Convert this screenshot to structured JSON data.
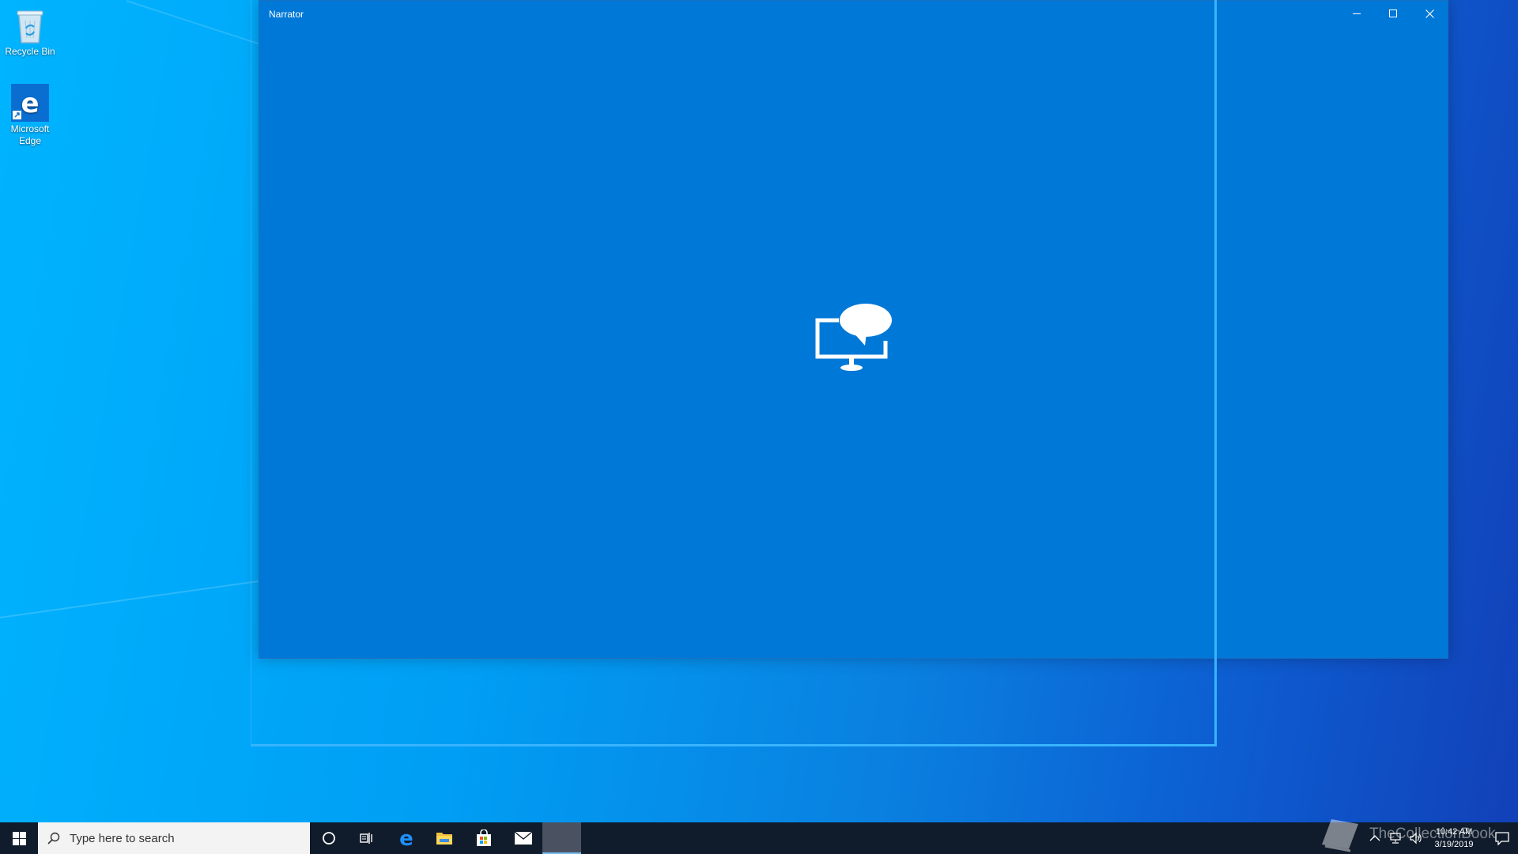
{
  "desktop": {
    "icons": [
      {
        "label": "Recycle Bin",
        "icon": "recycle-bin-icon"
      },
      {
        "label": "Microsoft\nEdge",
        "icon": "edge-icon"
      }
    ]
  },
  "window": {
    "title": "Narrator",
    "controls": [
      "minimize-icon",
      "maximize-icon",
      "close-icon"
    ],
    "center_icon": "narrator-icon"
  },
  "taskbar": {
    "search_placeholder": "Type here to search",
    "apps": [
      "cortana-icon",
      "task-view-icon",
      "edge-icon",
      "file-explorer-icon",
      "store-icon",
      "mail-icon",
      "narrator-icon"
    ],
    "clock": {
      "time": "10:42 AM",
      "date": "3/19/2019"
    },
    "watermark": "TheCollectionBook"
  },
  "colors": {
    "window_bg": "#0078d7",
    "taskbar_bg": "#101c2c",
    "focus_outline": "#39b4ff"
  }
}
